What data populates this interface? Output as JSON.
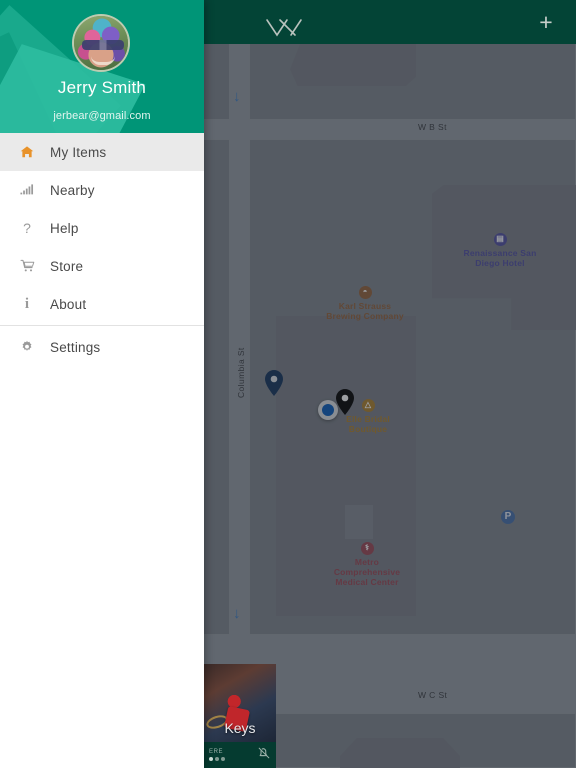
{
  "app": {
    "topbar": {
      "logo_name": "xy-logo-icon",
      "add_label": "+"
    }
  },
  "drawer": {
    "profile": {
      "name": "Jerry Smith",
      "email": "jerbear@gmail.com",
      "avatar_name": "user-avatar"
    },
    "items": [
      {
        "label": "My Items",
        "icon": "home-icon",
        "glyph": "⌂",
        "active": true
      },
      {
        "label": "Nearby",
        "icon": "signal-icon",
        "glyph": "὏6",
        "active": false
      },
      {
        "label": "Help",
        "icon": "question-icon",
        "glyph": "?",
        "active": false
      },
      {
        "label": "Store",
        "icon": "cart-icon",
        "glyph": "Ὥ2",
        "active": false
      },
      {
        "label": "About",
        "icon": "info-icon",
        "glyph": "i",
        "active": false
      },
      {
        "label": "Settings",
        "icon": "gear-icon",
        "glyph": "⚙",
        "active": false
      }
    ]
  },
  "map": {
    "streets": [
      {
        "name": "W B St",
        "orientation": "horizontal"
      },
      {
        "name": "W C St",
        "orientation": "horizontal"
      },
      {
        "name": "Columbia St",
        "orientation": "vertical"
      }
    ],
    "pois": [
      {
        "name": "Renaissance San Diego\nDiego Hotel",
        "label_line1": "Renaissance San",
        "label_line2": "Diego Hotel",
        "color": "#5a59a8",
        "icon": "hotel-icon"
      },
      {
        "label_line1": "Karl Strauss",
        "label_line2": "Brewing Company",
        "color": "#9a6b47",
        "icon": "brewery-icon"
      },
      {
        "label_line1": "Elle Bridal",
        "label_line2": "Boutique",
        "color": "#b2883a",
        "icon": "shopping-bag-icon"
      },
      {
        "label_line1": "Metro",
        "label_line2": "Comprehensive",
        "label_line3": "Medical Center",
        "color": "#a0515f",
        "icon": "hospital-icon"
      }
    ],
    "parking": {
      "label": "P",
      "color": "#5078b0"
    },
    "markers": [
      {
        "name": "item-pin-blue",
        "color": "#1f3f66"
      },
      {
        "name": "item-pin-black",
        "color": "#111111"
      },
      {
        "name": "current-location-dot",
        "color": "#1565c0"
      }
    ]
  },
  "item_card": {
    "title": "Keys",
    "footer_tag": "ERE",
    "bell_icon": "bell-off-icon"
  },
  "colors": {
    "topbar_green": "#034436",
    "drawer_teal": "#009577",
    "accent_orange": "#e8922a",
    "map_gray": "#8d939c"
  }
}
